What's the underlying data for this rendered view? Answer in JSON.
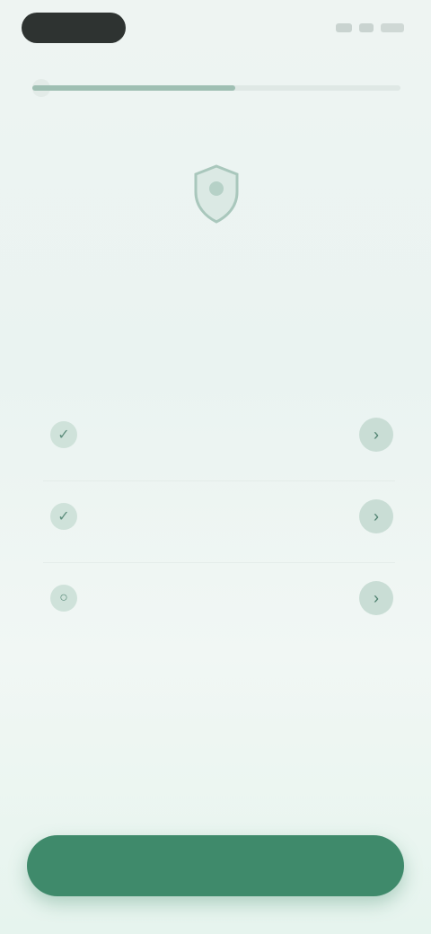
{
  "status_bar": {
    "time": ""
  },
  "progress": {
    "value": 0.55
  },
  "emblem": {
    "icon": "shield-icon"
  },
  "page": {
    "title": "",
    "subtitle": ""
  },
  "list": {
    "items": [
      {
        "icon": "check-circle-icon",
        "title": "",
        "description": "",
        "action_icon": "chevron-right-icon"
      },
      {
        "icon": "check-circle-icon",
        "title": "",
        "description": "",
        "action_icon": "chevron-right-icon"
      },
      {
        "icon": "circle-icon",
        "title": "",
        "description": "",
        "action_icon": "chevron-right-icon"
      }
    ]
  },
  "footer": {
    "primary_label": ""
  },
  "colors": {
    "accent": "#3f8a6b",
    "accent_light": "#cfe2da",
    "background": "#eef4f2"
  }
}
